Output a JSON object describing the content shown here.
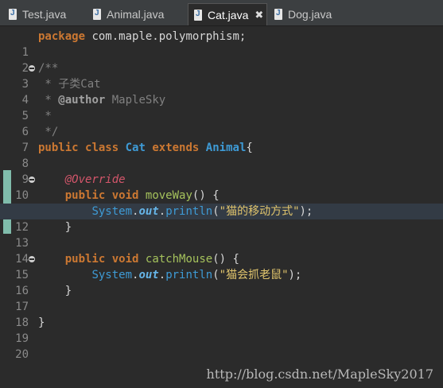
{
  "tabs": [
    {
      "label": "Test.java",
      "active": false
    },
    {
      "label": "Animal.java",
      "active": false
    },
    {
      "label": "Cat.java",
      "active": true
    },
    {
      "label": "Dog.java",
      "active": false
    }
  ],
  "close_glyph": "✖",
  "code": {
    "l1_kw": "package",
    "l1_rest": " com.maple.polymorphism;",
    "l3": "/**",
    "l4": " * 子类Cat",
    "l5_a": " * ",
    "l5_tag": "@author",
    "l5_b": " MapleSky",
    "l6": " *",
    "l7": " */",
    "l8_kw1": "public",
    "l8_kw2": "class",
    "l8_cls": "Cat",
    "l8_kw3": "extends",
    "l8_cls2": "Animal",
    "l8_brace": "{",
    "l10_ann": "@Override",
    "l11_kw1": "public",
    "l11_kw2": "void",
    "l11_m": "moveWay",
    "l11_rest": "() {",
    "l12_sys": "System",
    "l12_dot1": ".",
    "l12_out": "out",
    "l12_dot2": ".",
    "l12_m": "println",
    "l12_p1": "(",
    "l12_str": "\"猫的移动方式\"",
    "l12_p2": ");",
    "l13": "}",
    "l15_kw1": "public",
    "l15_kw2": "void",
    "l15_m": "catchMouse",
    "l15_rest": "() {",
    "l16_sys": "System",
    "l16_dot1": ".",
    "l16_out": "out",
    "l16_dot2": ".",
    "l16_m": "println",
    "l16_p1": "(",
    "l16_str": "\"猫会抓老鼠\"",
    "l16_p2": ");",
    "l17": "}",
    "l19": "}"
  },
  "line_numbers": [
    "1",
    "2",
    "3",
    "4",
    "5",
    "6",
    "7",
    "8",
    "9",
    "10",
    "11",
    "12",
    "13",
    "14",
    "15",
    "16",
    "17",
    "18",
    "19",
    "20"
  ],
  "watermark": "http://blog.csdn.net/MapleSky2017",
  "colors": {
    "keyword": "#cc7832",
    "class": "#3e9bd6",
    "annotation": "#d4566b",
    "method": "#a5c25c",
    "string": "#e0c46c",
    "comment": "#808080"
  }
}
